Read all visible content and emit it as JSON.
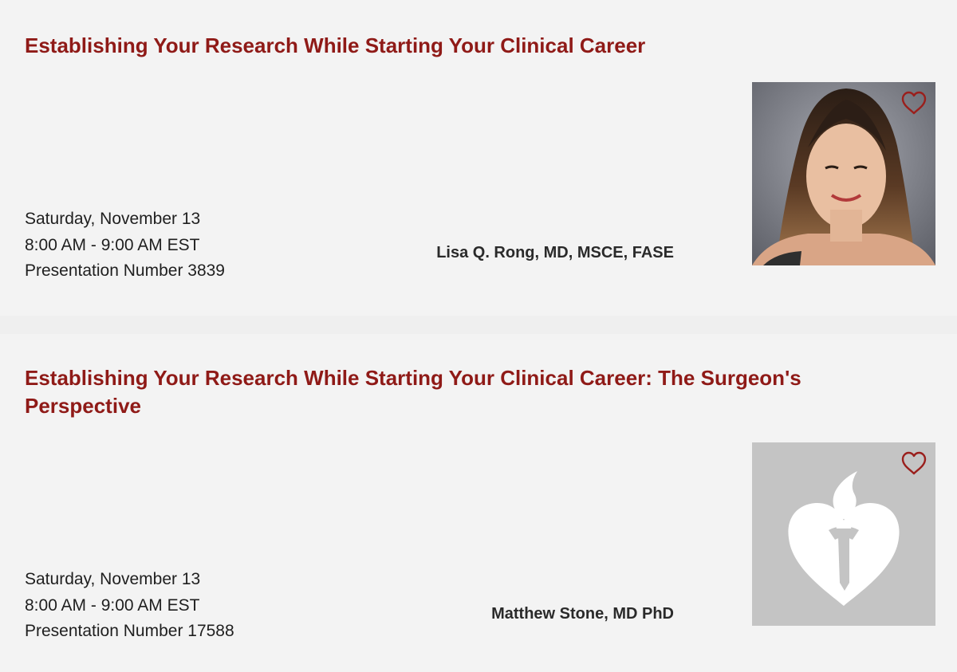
{
  "sessions": [
    {
      "title": "Establishing Your Research While Starting Your Clinical Career",
      "date": "Saturday, November 13",
      "time": "8:00 AM - 9:00 AM EST",
      "presentation": "Presentation Number 3839",
      "speaker": "Lisa Q. Rong, MD, MSCE, FASE",
      "photo": "speaker-portrait",
      "favorite_icon": "heart-outline-icon"
    },
    {
      "title": "Establishing Your Research While Starting Your Clinical Career: The Surgeon's Perspective",
      "date": "Saturday, November 13",
      "time": "8:00 AM - 9:00 AM EST",
      "presentation": "Presentation Number 17588",
      "speaker": "Matthew Stone, MD PhD",
      "photo": "aha-heart-torch-placeholder",
      "favorite_icon": "heart-outline-icon"
    }
  ],
  "colors": {
    "title": "#8f1a17",
    "card_bg": "#f3f3f3",
    "page_bg": "#efefef",
    "heart": "#9a1f1c",
    "placeholder_bg": "#c4c4c4"
  }
}
